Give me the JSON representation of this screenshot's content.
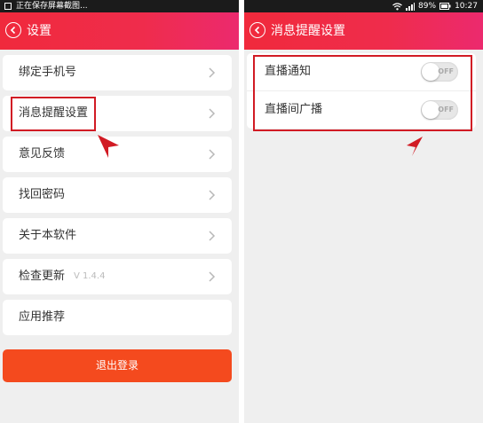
{
  "left": {
    "status_text": "正在保存屏幕截图...",
    "title": "设置",
    "menu": [
      {
        "label": "绑定手机号"
      },
      {
        "label": "消息提醒设置"
      },
      {
        "label": "意见反馈"
      },
      {
        "label": "找回密码"
      },
      {
        "label": "关于本软件"
      },
      {
        "label": "检查更新",
        "version": "V 1.4.4"
      },
      {
        "label": "应用推荐"
      }
    ],
    "logout_label": "退出登录"
  },
  "right": {
    "status": {
      "battery": "89%",
      "time": "10:27"
    },
    "title": "消息提醒设置",
    "toggles": [
      {
        "label": "直播通知",
        "state": "OFF"
      },
      {
        "label": "直播间广播",
        "state": "OFF"
      }
    ]
  },
  "colors": {
    "appbar": "#ef2c4c",
    "logout_button": "#f44a1e",
    "highlight": "#d11b24",
    "background": "#efefef"
  },
  "icons": [
    "back-icon",
    "chevron-right-icon",
    "wifi-icon",
    "signal-icon",
    "battery-icon",
    "screenshot-icon"
  ]
}
